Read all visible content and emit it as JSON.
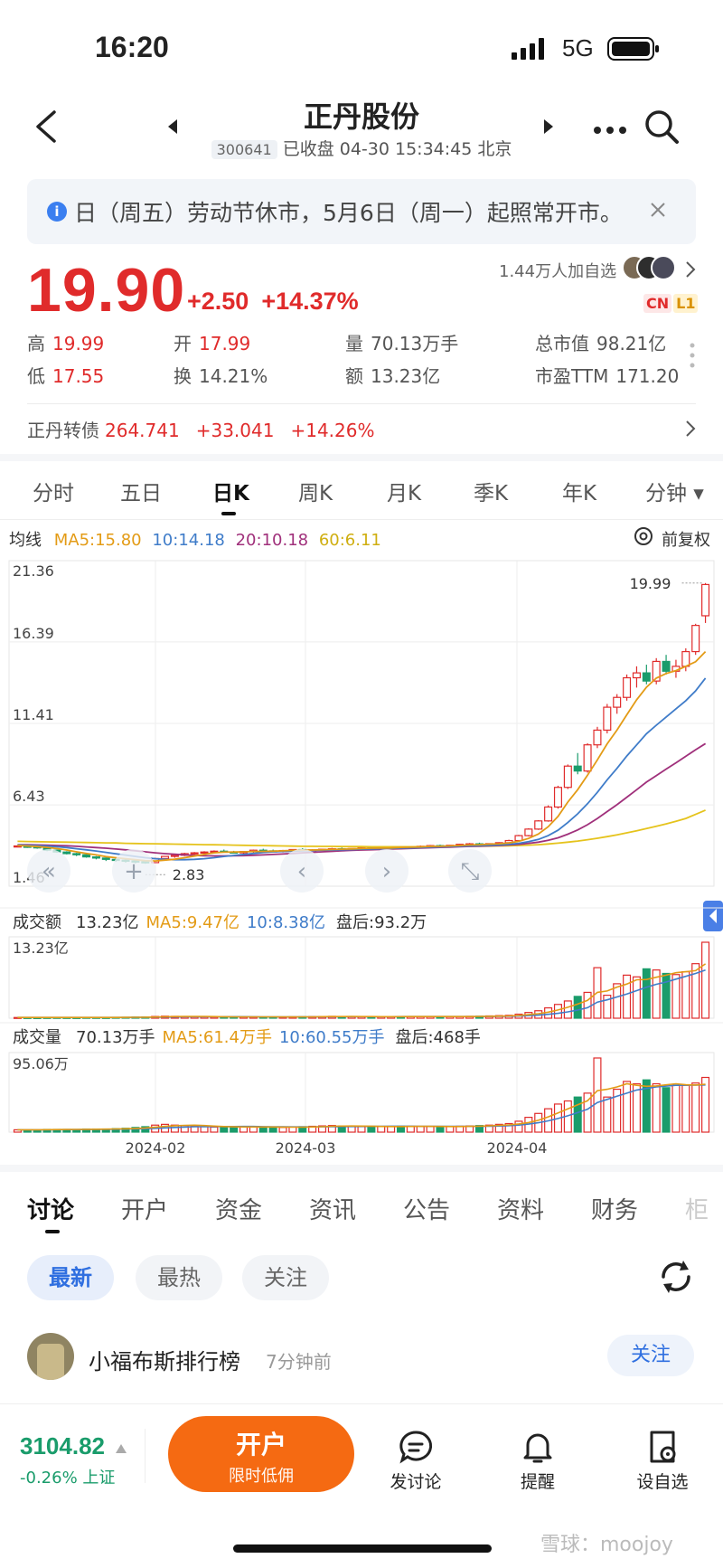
{
  "status": {
    "time": "16:20",
    "network": "5G"
  },
  "header": {
    "title": "正丹股份",
    "code": "300641",
    "status_text": "已收盘 04-30 15:34:45 北京"
  },
  "notice": {
    "text": "日（周五）劳动节休市，5月6日（周一）起照常开市。"
  },
  "quote": {
    "price": "19.90",
    "change": "+2.50",
    "change_pct": "+14.37%",
    "followers": "1.44万人加自选",
    "badge_cn": "CN",
    "badge_l1": "L1",
    "stats": [
      {
        "label": "高",
        "value": "19.99",
        "color": "red"
      },
      {
        "label": "开",
        "value": "17.99",
        "color": "red"
      },
      {
        "label": "量",
        "value": "70.13万手",
        "color": "plain"
      },
      {
        "label": "总市值",
        "value": "98.21亿",
        "color": "plain"
      },
      {
        "label": "低",
        "value": "17.55",
        "color": "red"
      },
      {
        "label": "换",
        "value": "14.21%",
        "color": "plain"
      },
      {
        "label": "额",
        "value": "13.23亿",
        "color": "plain"
      },
      {
        "label": "市盈TTM",
        "value": "171.20",
        "color": "plain"
      }
    ],
    "bond": {
      "name": "正丹转债",
      "price": "264.741",
      "change": "+33.041",
      "pct": "+14.26%"
    }
  },
  "kline_tabs": [
    "分时",
    "五日",
    "日K",
    "周K",
    "月K",
    "季K",
    "年K",
    "分钟"
  ],
  "kline_active": "日K",
  "chart_legend": {
    "label": "均线",
    "ma5": "MA5:15.80",
    "ma10": "10:14.18",
    "ma20": "20:10.18",
    "ma60": "60:6.11",
    "adjust": "前复权"
  },
  "colors": {
    "up": "#e02b2b",
    "down": "#1a9c6b",
    "ma5": "#e39b16",
    "ma10": "#3f7cc9",
    "ma20": "#a0307b",
    "ma60": "#e5c31c"
  },
  "chart_data": {
    "type": "candlestick",
    "y_ticks": [
      "21.36",
      "16.39",
      "11.41",
      "6.43",
      "1.46"
    ],
    "ylim": [
      1.46,
      21.36
    ],
    "x_ticks": [
      "2024-02",
      "2024-03",
      "2024-04"
    ],
    "high_label": "19.99",
    "low_label": "2.83",
    "candles": [
      [
        3.9,
        3.95,
        3.85,
        3.92
      ],
      [
        3.9,
        3.92,
        3.8,
        3.88
      ],
      [
        3.88,
        3.9,
        3.75,
        3.8
      ],
      [
        3.8,
        3.82,
        3.6,
        3.66
      ],
      [
        3.66,
        3.7,
        3.5,
        3.55
      ],
      [
        3.55,
        3.6,
        3.4,
        3.45
      ],
      [
        3.45,
        3.5,
        3.3,
        3.38
      ],
      [
        3.38,
        3.42,
        3.2,
        3.25
      ],
      [
        3.25,
        3.3,
        3.1,
        3.18
      ],
      [
        3.18,
        3.22,
        3.0,
        3.1
      ],
      [
        3.1,
        3.15,
        2.95,
        3.05
      ],
      [
        3.05,
        3.1,
        2.9,
        3.0
      ],
      [
        3.0,
        3.1,
        2.85,
        2.95
      ],
      [
        2.95,
        3.0,
        2.83,
        2.9
      ],
      [
        2.9,
        3.2,
        2.88,
        3.15
      ],
      [
        3.15,
        3.3,
        3.1,
        3.28
      ],
      [
        3.28,
        3.4,
        3.2,
        3.35
      ],
      [
        3.35,
        3.5,
        3.3,
        3.45
      ],
      [
        3.45,
        3.55,
        3.38,
        3.5
      ],
      [
        3.5,
        3.6,
        3.45,
        3.55
      ],
      [
        3.55,
        3.65,
        3.48,
        3.6
      ],
      [
        3.6,
        3.7,
        3.52,
        3.55
      ],
      [
        3.55,
        3.62,
        3.45,
        3.5
      ],
      [
        3.5,
        3.6,
        3.42,
        3.58
      ],
      [
        3.58,
        3.7,
        3.5,
        3.66
      ],
      [
        3.66,
        3.75,
        3.58,
        3.62
      ],
      [
        3.62,
        3.7,
        3.55,
        3.6
      ],
      [
        3.6,
        3.68,
        3.52,
        3.64
      ],
      [
        3.64,
        3.72,
        3.58,
        3.7
      ],
      [
        3.7,
        3.78,
        3.62,
        3.66
      ],
      [
        3.66,
        3.72,
        3.6,
        3.68
      ],
      [
        3.68,
        3.75,
        3.62,
        3.72
      ],
      [
        3.72,
        3.8,
        3.66,
        3.75
      ],
      [
        3.75,
        3.82,
        3.68,
        3.7
      ],
      [
        3.7,
        3.78,
        3.64,
        3.76
      ],
      [
        3.76,
        3.85,
        3.7,
        3.8
      ],
      [
        3.8,
        3.88,
        3.72,
        3.78
      ],
      [
        3.78,
        3.84,
        3.7,
        3.82
      ],
      [
        3.82,
        3.9,
        3.76,
        3.86
      ],
      [
        3.86,
        3.92,
        3.8,
        3.84
      ],
      [
        3.84,
        3.9,
        3.78,
        3.88
      ],
      [
        3.88,
        3.95,
        3.82,
        3.9
      ],
      [
        3.9,
        3.98,
        3.84,
        3.94
      ],
      [
        3.94,
        4.0,
        3.88,
        3.92
      ],
      [
        3.92,
        3.98,
        3.86,
        3.96
      ],
      [
        3.96,
        4.05,
        3.9,
        4.02
      ],
      [
        4.02,
        4.1,
        3.96,
        4.05
      ],
      [
        4.05,
        4.12,
        3.98,
        4.0
      ],
      [
        4.0,
        4.08,
        3.95,
        4.06
      ],
      [
        4.06,
        4.15,
        4.0,
        4.12
      ],
      [
        4.12,
        4.3,
        4.08,
        4.25
      ],
      [
        4.25,
        4.6,
        4.2,
        4.55
      ],
      [
        4.55,
        5.0,
        4.5,
        4.95
      ],
      [
        4.95,
        5.5,
        4.9,
        5.45
      ],
      [
        5.45,
        6.4,
        5.4,
        6.3
      ],
      [
        6.3,
        7.6,
        6.2,
        7.5
      ],
      [
        7.5,
        8.9,
        7.4,
        8.8
      ],
      [
        8.8,
        9.6,
        8.3,
        8.5
      ],
      [
        8.5,
        10.2,
        8.4,
        10.1
      ],
      [
        10.1,
        11.2,
        9.9,
        11.0
      ],
      [
        11.0,
        12.6,
        10.8,
        12.4
      ],
      [
        12.4,
        13.2,
        12.0,
        13.0
      ],
      [
        13.0,
        14.4,
        12.8,
        14.2
      ],
      [
        14.2,
        14.9,
        13.6,
        14.5
      ],
      [
        14.5,
        15.0,
        13.8,
        14.0
      ],
      [
        14.0,
        15.4,
        13.8,
        15.2
      ],
      [
        15.2,
        15.6,
        14.4,
        14.6
      ],
      [
        14.6,
        15.3,
        14.2,
        14.9
      ],
      [
        14.9,
        16.0,
        14.6,
        15.8
      ],
      [
        15.8,
        17.5,
        15.6,
        17.4
      ],
      [
        17.99,
        19.99,
        17.55,
        19.9
      ]
    ],
    "ma5": [
      3.95,
      3.92,
      3.88,
      3.83,
      3.76,
      3.67,
      3.56,
      3.46,
      3.37,
      3.27,
      3.2,
      3.14,
      3.08,
      3.02,
      3.0,
      3.05,
      3.11,
      3.2,
      3.3,
      3.4,
      3.5,
      3.54,
      3.55,
      3.56,
      3.58,
      3.59,
      3.6,
      3.62,
      3.65,
      3.66,
      3.67,
      3.69,
      3.71,
      3.72,
      3.74,
      3.76,
      3.78,
      3.79,
      3.8,
      3.83,
      3.84,
      3.86,
      3.89,
      3.9,
      3.92,
      3.95,
      3.98,
      4.0,
      4.03,
      4.05,
      4.1,
      4.2,
      4.38,
      4.65,
      5.1,
      5.73,
      6.6,
      7.36,
      8.24,
      9.18,
      10.16,
      11.0,
      11.94,
      12.86,
      13.62,
      14.18,
      14.46,
      14.64,
      14.9,
      15.18,
      15.8
    ],
    "ma10": [
      3.98,
      3.96,
      3.94,
      3.91,
      3.87,
      3.82,
      3.75,
      3.68,
      3.61,
      3.53,
      3.44,
      3.36,
      3.28,
      3.2,
      3.14,
      3.1,
      3.08,
      3.08,
      3.1,
      3.14,
      3.2,
      3.28,
      3.34,
      3.4,
      3.46,
      3.52,
      3.56,
      3.58,
      3.6,
      3.62,
      3.64,
      3.66,
      3.67,
      3.69,
      3.7,
      3.72,
      3.73,
      3.75,
      3.77,
      3.79,
      3.8,
      3.82,
      3.84,
      3.86,
      3.88,
      3.9,
      3.92,
      3.94,
      3.96,
      3.98,
      4.02,
      4.08,
      4.18,
      4.32,
      4.55,
      4.88,
      5.35,
      5.88,
      6.5,
      7.2,
      7.96,
      8.66,
      9.42,
      10.1,
      10.78,
      11.3,
      11.8,
      12.3,
      12.8,
      13.4,
      14.18
    ],
    "ma20": [
      4.0,
      3.99,
      3.98,
      3.97,
      3.95,
      3.93,
      3.9,
      3.86,
      3.82,
      3.78,
      3.73,
      3.68,
      3.62,
      3.56,
      3.5,
      3.45,
      3.41,
      3.37,
      3.34,
      3.32,
      3.31,
      3.31,
      3.32,
      3.33,
      3.35,
      3.37,
      3.4,
      3.43,
      3.46,
      3.5,
      3.53,
      3.56,
      3.59,
      3.62,
      3.65,
      3.67,
      3.69,
      3.71,
      3.73,
      3.75,
      3.77,
      3.79,
      3.81,
      3.83,
      3.85,
      3.87,
      3.89,
      3.91,
      3.93,
      3.95,
      3.98,
      4.02,
      4.08,
      4.15,
      4.26,
      4.42,
      4.64,
      4.9,
      5.22,
      5.6,
      6.02,
      6.44,
      6.9,
      7.36,
      7.82,
      8.22,
      8.62,
      9.0,
      9.4,
      9.8,
      10.18
    ],
    "ma60": [
      4.2,
      4.19,
      4.18,
      4.17,
      4.16,
      4.15,
      4.14,
      4.13,
      4.12,
      4.11,
      4.1,
      4.08,
      4.07,
      4.06,
      4.05,
      4.04,
      4.03,
      4.02,
      4.01,
      4.0,
      3.99,
      3.98,
      3.97,
      3.96,
      3.95,
      3.94,
      3.93,
      3.92,
      3.91,
      3.9,
      3.9,
      3.89,
      3.89,
      3.88,
      3.88,
      3.88,
      3.87,
      3.87,
      3.87,
      3.87,
      3.87,
      3.87,
      3.88,
      3.88,
      3.89,
      3.89,
      3.9,
      3.9,
      3.91,
      3.92,
      3.93,
      3.95,
      3.97,
      4.0,
      4.04,
      4.09,
      4.15,
      4.22,
      4.3,
      4.39,
      4.49,
      4.6,
      4.72,
      4.85,
      4.98,
      5.12,
      5.27,
      5.43,
      5.6,
      5.85,
      6.11
    ]
  },
  "turnover": {
    "label": "成交额",
    "value": "13.23亿",
    "ma5": "MA5:9.47亿",
    "ma10": "10:8.38亿",
    "after": "盘后:93.2万",
    "max_label": "13.23亿",
    "max": 13.23,
    "values": [
      0.12,
      0.11,
      0.1,
      0.12,
      0.13,
      0.12,
      0.11,
      0.14,
      0.13,
      0.12,
      0.15,
      0.16,
      0.2,
      0.22,
      0.3,
      0.35,
      0.32,
      0.3,
      0.28,
      0.25,
      0.22,
      0.2,
      0.22,
      0.25,
      0.24,
      0.22,
      0.2,
      0.22,
      0.24,
      0.26,
      0.28,
      0.3,
      0.32,
      0.3,
      0.28,
      0.26,
      0.25,
      0.27,
      0.28,
      0.3,
      0.29,
      0.28,
      0.27,
      0.26,
      0.28,
      0.3,
      0.32,
      0.35,
      0.4,
      0.45,
      0.5,
      0.7,
      1.0,
      1.3,
      1.8,
      2.4,
      3.0,
      3.8,
      4.5,
      8.8,
      4.0,
      6.0,
      7.5,
      7.2,
      8.6,
      8.4,
      7.8,
      7.6,
      8.1,
      9.5,
      13.23
    ],
    "ma5_line": [
      0.12,
      0.12,
      0.12,
      0.12,
      0.12,
      0.12,
      0.12,
      0.12,
      0.13,
      0.13,
      0.13,
      0.14,
      0.15,
      0.17,
      0.2,
      0.25,
      0.28,
      0.3,
      0.3,
      0.3,
      0.28,
      0.25,
      0.23,
      0.23,
      0.23,
      0.23,
      0.23,
      0.23,
      0.22,
      0.23,
      0.24,
      0.26,
      0.28,
      0.29,
      0.3,
      0.29,
      0.28,
      0.27,
      0.27,
      0.27,
      0.28,
      0.28,
      0.28,
      0.28,
      0.28,
      0.28,
      0.29,
      0.3,
      0.33,
      0.36,
      0.4,
      0.48,
      0.61,
      0.79,
      1.06,
      1.44,
      1.9,
      2.46,
      3.1,
      4.5,
      4.74,
      5.42,
      5.96,
      6.7,
      6.74,
      7.14,
      7.5,
      7.92,
      8.1,
      8.28,
      9.47
    ],
    "ma10_line": [
      0.12,
      0.12,
      0.12,
      0.12,
      0.12,
      0.12,
      0.12,
      0.12,
      0.12,
      0.12,
      0.13,
      0.13,
      0.14,
      0.15,
      0.16,
      0.19,
      0.21,
      0.23,
      0.24,
      0.25,
      0.26,
      0.26,
      0.26,
      0.26,
      0.25,
      0.24,
      0.24,
      0.24,
      0.24,
      0.24,
      0.24,
      0.25,
      0.25,
      0.26,
      0.27,
      0.27,
      0.27,
      0.27,
      0.27,
      0.28,
      0.28,
      0.28,
      0.28,
      0.28,
      0.28,
      0.28,
      0.28,
      0.29,
      0.3,
      0.32,
      0.34,
      0.38,
      0.45,
      0.54,
      0.67,
      0.85,
      1.1,
      1.42,
      1.82,
      2.8,
      3.2,
      3.7,
      4.2,
      4.8,
      5.4,
      5.9,
      6.3,
      6.8,
      7.3,
      7.8,
      8.38
    ],
    "dates": []
  },
  "volume": {
    "label": "成交量",
    "value": "70.13万手",
    "ma5": "MA5:61.4万手",
    "ma10": "10:60.55万手",
    "after": "盘后:468手",
    "max_label": "95.06万",
    "max": 95.06,
    "values": [
      3,
      3,
      3,
      3.5,
      3.5,
      3.5,
      3.5,
      4,
      4,
      4,
      4.5,
      5,
      6,
      7,
      9,
      10,
      9,
      8.5,
      8,
      7,
      6.5,
      6,
      6.5,
      7,
      7,
      6.5,
      6,
      6,
      6.5,
      7,
      7.5,
      8,
      8.5,
      8,
      7.5,
      7,
      7,
      7.2,
      7.4,
      7.6,
      7.5,
      7.3,
      7.1,
      7,
      7.2,
      7.6,
      8,
      8.5,
      9,
      10,
      11,
      14,
      19,
      24,
      30,
      36,
      40,
      45,
      50,
      95.06,
      45,
      55,
      65,
      62,
      67,
      62,
      57,
      60,
      60,
      63,
      70.13
    ],
    "ma5_line": [
      3,
      3,
      3,
      3.1,
      3.2,
      3.4,
      3.5,
      3.6,
      3.7,
      3.8,
      4,
      4.3,
      4.7,
      5.3,
      6.3,
      7.4,
      8.2,
      8.7,
      8.9,
      8.5,
      7.8,
      7.2,
      6.8,
      6.6,
      6.6,
      6.6,
      6.6,
      6.5,
      6.4,
      6.4,
      6.6,
      7,
      7.5,
      7.8,
      7.9,
      7.8,
      7.6,
      7.3,
      7.2,
      7.2,
      7.3,
      7.4,
      7.4,
      7.3,
      7.2,
      7.2,
      7.4,
      7.7,
      8.1,
      8.7,
      9.3,
      10.5,
      12.3,
      15.2,
      19.6,
      24.6,
      29.8,
      35,
      40.2,
      53.2,
      55,
      58,
      62,
      60,
      58.8,
      59.2,
      60.6,
      62,
      60.8,
      60.4,
      61.4
    ],
    "ma10_line": [
      3,
      3,
      3,
      3,
      3.1,
      3.2,
      3.3,
      3.4,
      3.5,
      3.6,
      3.7,
      3.9,
      4.1,
      4.4,
      4.9,
      5.5,
      6,
      6.5,
      6.9,
      7.1,
      7.2,
      7.2,
      7.2,
      7.3,
      7.3,
      7.1,
      6.9,
      6.8,
      6.7,
      6.7,
      6.7,
      6.8,
      6.9,
      7.1,
      7.2,
      7.3,
      7.4,
      7.5,
      7.6,
      7.6,
      7.6,
      7.5,
      7.5,
      7.4,
      7.4,
      7.4,
      7.4,
      7.5,
      7.6,
      7.9,
      8.3,
      9.1,
      10.3,
      12.1,
      14.5,
      17.5,
      21,
      25,
      29.5,
      38,
      42,
      46,
      50,
      54,
      56,
      58,
      59,
      60,
      60.2,
      60.4,
      60.55
    ]
  },
  "bottom_tabs": [
    "讨论",
    "开户",
    "资金",
    "资讯",
    "公告",
    "资料",
    "财务",
    "柜"
  ],
  "bottom_active": "讨论",
  "filters": [
    "最新",
    "最热",
    "关注"
  ],
  "post": {
    "user": "小福布斯排行榜",
    "time": "7分钟前",
    "follow": "关注"
  },
  "index": {
    "value": "3104.82",
    "change": "-0.26% 上证"
  },
  "open_account": {
    "title": "开户",
    "subtitle": "限时低佣"
  },
  "actions": [
    {
      "label": "发讨论",
      "icon": "comment-icon"
    },
    {
      "label": "提醒",
      "icon": "bell-icon"
    },
    {
      "label": "设自选",
      "icon": "add-watchlist-icon"
    }
  ],
  "watermark": "雪球：moojoy"
}
